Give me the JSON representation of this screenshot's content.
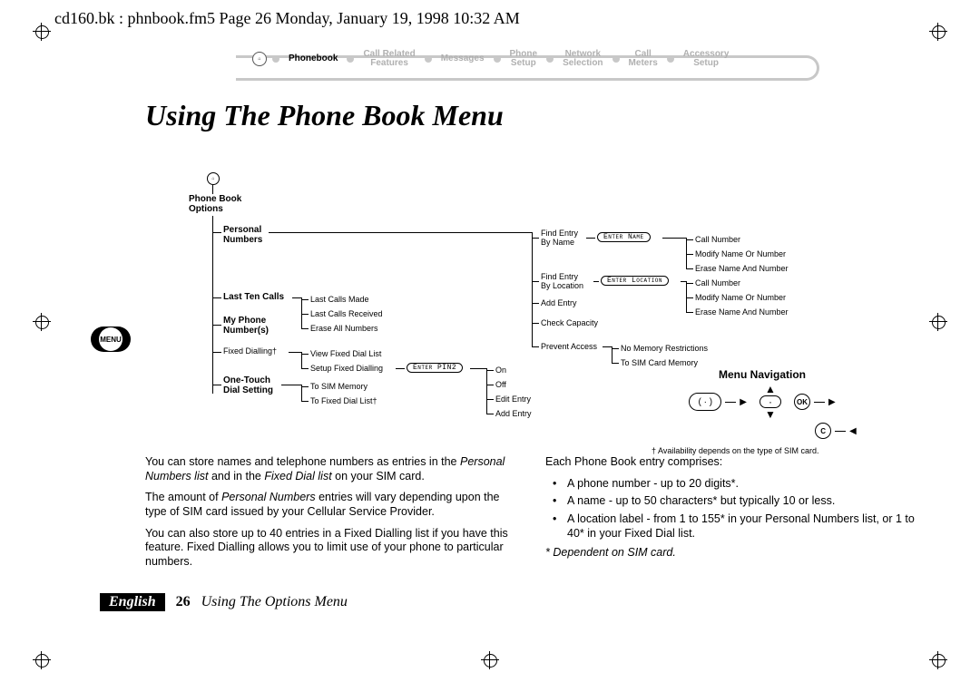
{
  "header": "cd160.bk : phnbook.fm5  Page 26  Monday, January 19, 1998  10:32 AM",
  "nav": {
    "items": [
      "Phonebook",
      "Call Related\nFeatures",
      "Messages",
      "Phone\nSetup",
      "Network\nSelection",
      "Call\nMeters",
      "Accessory\nSetup"
    ],
    "active_index": 0
  },
  "title": "Using The Phone Book Menu",
  "menu_badge": "MENU",
  "tree": {
    "root": "Phone Book\nOptions",
    "level1": [
      "Personal\nNumbers",
      "Last Ten Calls",
      "My Phone\nNumber(s)",
      "Fixed Dialling",
      "One-Touch\nDial Setting"
    ],
    "fixed_dialling_dagger": true,
    "last_ten_calls_children": [
      "Last Calls Made",
      "Last Calls Received",
      "Erase All Numbers"
    ],
    "fixed_dialling_children": [
      "View Fixed Dial List",
      "Setup Fixed Dialling"
    ],
    "one_touch_children": [
      "To SIM Memory",
      "To Fixed Dial List"
    ],
    "one_touch_last_dagger": true,
    "setup_fixed_chip": "Enter PIN2",
    "setup_fixed_children": [
      "On",
      "Off",
      "Edit Entry",
      "Add Entry"
    ],
    "personal_children": [
      "Find Entry\nBy Name",
      "Find Entry\nBy Location",
      "Add Entry",
      "Check Capacity",
      "Prevent Access"
    ],
    "find_name_chip": "Enter Name",
    "find_loc_chip": "Enter Location",
    "entry_actions": [
      "Call Number",
      "Modify Name Or Number",
      "Erase Name And Number"
    ],
    "prevent_children": [
      "No Memory Restrictions",
      "To SIM Card Memory"
    ]
  },
  "navbox": {
    "title": "Menu Navigation",
    "ok": "OK",
    "c": "C",
    "footnote": "† Availability depends on the type of SIM card."
  },
  "body": {
    "left": {
      "p1a": "You can store names and telephone numbers as entries in the ",
      "p1b_i": "Personal Numbers list",
      "p1c": " and in the ",
      "p1d_i": "Fixed Dial list",
      "p1e": " on your SIM card.",
      "p2a": "The amount of ",
      "p2b_i": "Personal Numbers",
      "p2c": " entries will vary depending upon the type of SIM card issued by your Cellular Service Provider.",
      "p3": "You can also store up to 40 entries in a Fixed Dialling list if you have this feature. Fixed Dialling allows you to limit use of your phone to particular numbers."
    },
    "right": {
      "intro": "Each Phone Book entry comprises:",
      "bullets": [
        "A phone number - up to 20 digits*.",
        "A name - up to 50 characters* but typically 10 or less.",
        "A location label - from 1 to 155* in your Personal Numbers list, or 1 to 40* in your Fixed Dial list."
      ],
      "foot_i": "* Dependent on SIM card."
    }
  },
  "footer": {
    "lang": "English",
    "page": "26",
    "section": "Using The Options Menu"
  }
}
